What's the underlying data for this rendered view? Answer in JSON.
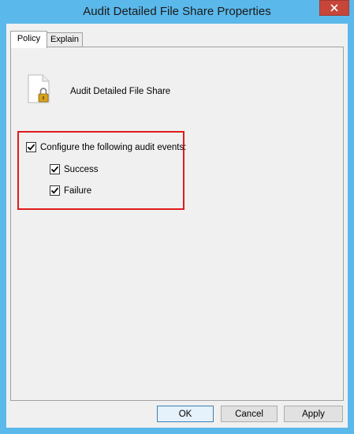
{
  "window": {
    "title": "Audit Detailed File Share Properties"
  },
  "tabs": [
    {
      "label": "Policy",
      "selected": true
    },
    {
      "label": "Explain",
      "selected": false
    }
  ],
  "policy": {
    "name": "Audit Detailed File Share",
    "icon": "document-lock-icon"
  },
  "audit_events": {
    "configure_label": "Configure the following audit events:",
    "configure_checked": true,
    "success_label": "Success",
    "success_checked": true,
    "failure_label": "Failure",
    "failure_checked": true
  },
  "buttons": {
    "ok": "OK",
    "cancel": "Cancel",
    "apply": "Apply"
  },
  "colors": {
    "title_bar": "#5bb8ea",
    "close_button": "#c7463a",
    "highlight_border": "#e01b1b",
    "dialog_background": "#f0f0f0"
  }
}
